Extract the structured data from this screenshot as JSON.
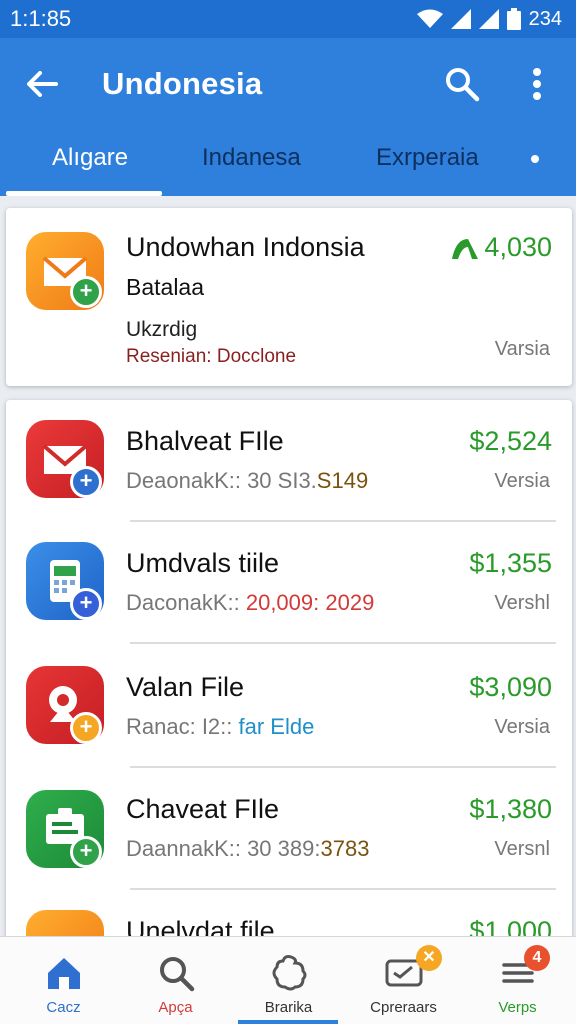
{
  "status": {
    "time": "1:1:85",
    "battery": "234"
  },
  "appbar": {
    "title": "Undonesia"
  },
  "tabs": [
    "Alıgare",
    "Indanesa",
    "Exrperaia"
  ],
  "featured": {
    "name": "Undowhan Indonsia",
    "line2": "Batalaa",
    "line3": "Ukzrdig",
    "line4_label": "Resenian:",
    "line4_value": "Docclone",
    "price": "4,030",
    "version": "Varsia"
  },
  "items": [
    {
      "name": "Bhalveat FIle",
      "sub_label": "DeaonakK:: 30 SI3.",
      "sub_value": "S149",
      "price": "$2,524",
      "version": "Versia"
    },
    {
      "name": "Umdvals tiile",
      "sub_label": "DaconakK:: ",
      "sub_value": "20,009: 2029",
      "price": "$1,355",
      "version": "Vershl"
    },
    {
      "name": "Valan File",
      "sub_label": "Ranac: I2:: ",
      "sub_value": "far Elde",
      "price": "$3,090",
      "version": "Versia"
    },
    {
      "name": "Chaveat FIle",
      "sub_label": "DaannakK:: 30 389:",
      "sub_value": "3783",
      "price": "$1,380",
      "version": "Versnl"
    },
    {
      "name": "Unelvdat file",
      "price": "$1,000"
    }
  ],
  "bottom_nav": [
    {
      "label": "Cacz",
      "color": "#2f6fd0"
    },
    {
      "label": "Apça",
      "color": "#d23a3a"
    },
    {
      "label": "Brarika",
      "color": "#333333"
    },
    {
      "label": "Cpreraars",
      "color": "#333333"
    },
    {
      "label": "Verps",
      "color": "#2a9b2a"
    }
  ],
  "colors": {
    "primary": "#2f80dc",
    "status_bar": "#1f6fd0",
    "price_green": "#2a9b2a"
  }
}
